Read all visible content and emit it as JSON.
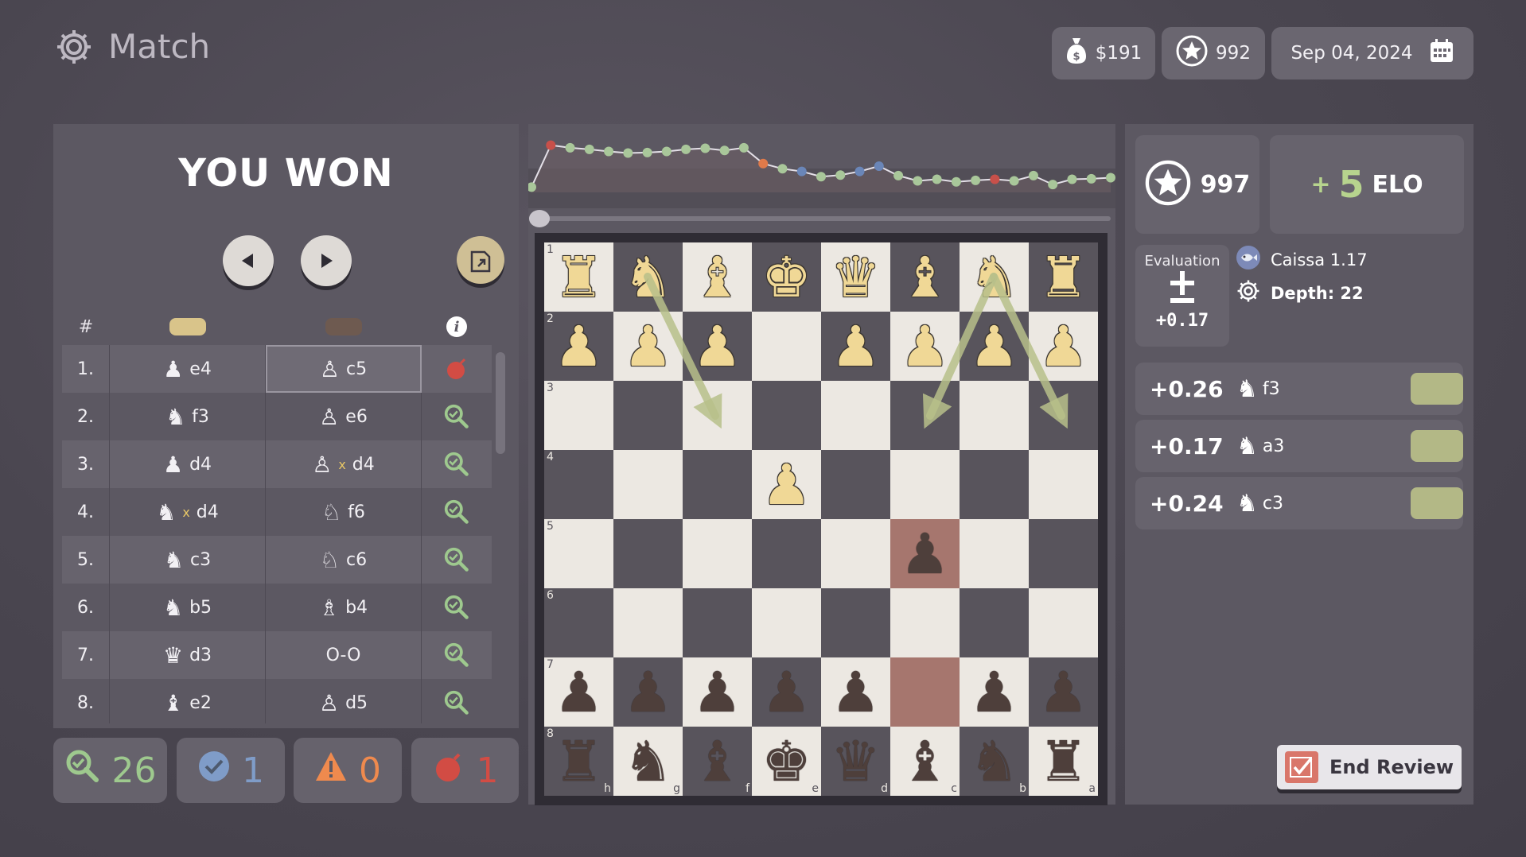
{
  "header": {
    "title": "Match",
    "money": "$191",
    "rating": "992",
    "date": "Sep 04, 2024"
  },
  "left": {
    "result": "YOU WON",
    "col_num": "#",
    "colors": {
      "white": "#d9c48a",
      "black": "#6e5a50"
    },
    "moves": [
      {
        "n": "1.",
        "w_piece": "pawn",
        "w": "e4",
        "w_cap": false,
        "b_piece": "pawn",
        "b": "c5",
        "b_cap": false,
        "q": "blunder"
      },
      {
        "n": "2.",
        "w_piece": "knight",
        "w": "f3",
        "w_cap": false,
        "b_piece": "pawn",
        "b": "e6",
        "b_cap": false,
        "q": "book"
      },
      {
        "n": "3.",
        "w_piece": "pawn",
        "w": "d4",
        "w_cap": false,
        "b_piece": "pawn",
        "b": "d4",
        "b_cap": true,
        "q": "book"
      },
      {
        "n": "4.",
        "w_piece": "knight",
        "w": "d4",
        "w_cap": true,
        "b_piece": "knight",
        "b": "f6",
        "b_cap": false,
        "q": "book"
      },
      {
        "n": "5.",
        "w_piece": "knight",
        "w": "c3",
        "w_cap": false,
        "b_piece": "knight",
        "b": "c6",
        "b_cap": false,
        "q": "book"
      },
      {
        "n": "6.",
        "w_piece": "knight",
        "w": "b5",
        "w_cap": false,
        "b_piece": "bishop",
        "b": "b4",
        "b_cap": false,
        "q": "book"
      },
      {
        "n": "7.",
        "w_piece": "queen",
        "w": "d3",
        "w_cap": false,
        "b_piece": "",
        "b": "O-O",
        "b_cap": false,
        "q": "book"
      },
      {
        "n": "8.",
        "w_piece": "bishop",
        "w": "e2",
        "w_cap": false,
        "b_piece": "pawn",
        "b": "d5",
        "b_cap": false,
        "q": "book"
      }
    ],
    "capture_mark": "x",
    "stats": {
      "book": "26",
      "best": "1",
      "mistake": "0",
      "blunder": "1"
    }
  },
  "graph": {
    "values": [
      0.1,
      0.9,
      0.85,
      0.82,
      0.78,
      0.75,
      0.76,
      0.78,
      0.82,
      0.84,
      0.8,
      0.85,
      0.55,
      0.45,
      0.4,
      0.3,
      0.33,
      0.4,
      0.5,
      0.32,
      0.22,
      0.25,
      0.2,
      0.23,
      0.25,
      0.22,
      0.32,
      0.15,
      0.25,
      0.26,
      0.28
    ],
    "colors": {
      "normal": "#a9c79a",
      "blunder": "#c8504a",
      "mistake": "#e07a4a",
      "best": "#6a86b8"
    },
    "marked": {
      "1": "blunder",
      "12": "mistake",
      "14": "best",
      "17": "best",
      "18": "best",
      "24": "blunder"
    }
  },
  "board": {
    "ranks": [
      "1",
      "2",
      "3",
      "4",
      "5",
      "6",
      "7",
      "8"
    ],
    "files": [
      "h",
      "g",
      "f",
      "e",
      "d",
      "c",
      "b",
      "a"
    ],
    "pieces": [
      [
        "wR",
        "wN",
        "wB",
        "wK",
        "wQ",
        "wB",
        "wN",
        "wR"
      ],
      [
        "wP",
        "wP",
        "wP",
        "",
        "wP",
        "wP",
        "wP",
        "wP"
      ],
      [
        "",
        "",
        "",
        "",
        "",
        "",
        "",
        ""
      ],
      [
        "",
        "",
        "",
        "wP",
        "",
        "",
        "",
        ""
      ],
      [
        "",
        "",
        "",
        "",
        "",
        "bP",
        "",
        ""
      ],
      [
        "",
        "",
        "",
        "",
        "",
        "",
        "",
        ""
      ],
      [
        "bP",
        "bP",
        "bP",
        "bP",
        "bP",
        "",
        "bP",
        "bP"
      ],
      [
        "bR",
        "bN",
        "bB",
        "bK",
        "bQ",
        "bB",
        "bN",
        "bR"
      ]
    ],
    "highlights": [
      "4-5",
      "6-5"
    ]
  },
  "right": {
    "rating": "997",
    "elo_plus": "+",
    "elo_value": "5",
    "elo_label": "ELO",
    "eval_label": "Evaluation",
    "eval_value": "+0.17",
    "engine": "Caissa 1.17",
    "depth": "Depth: 22",
    "best_moves": [
      {
        "score": "+0.26",
        "move": "f3"
      },
      {
        "score": "+0.17",
        "move": "a3"
      },
      {
        "score": "+0.24",
        "move": "c3"
      }
    ],
    "end_review": "End Review"
  },
  "theme": {
    "accent_arrow": "#b7c08a",
    "panel": "#5c5862"
  }
}
